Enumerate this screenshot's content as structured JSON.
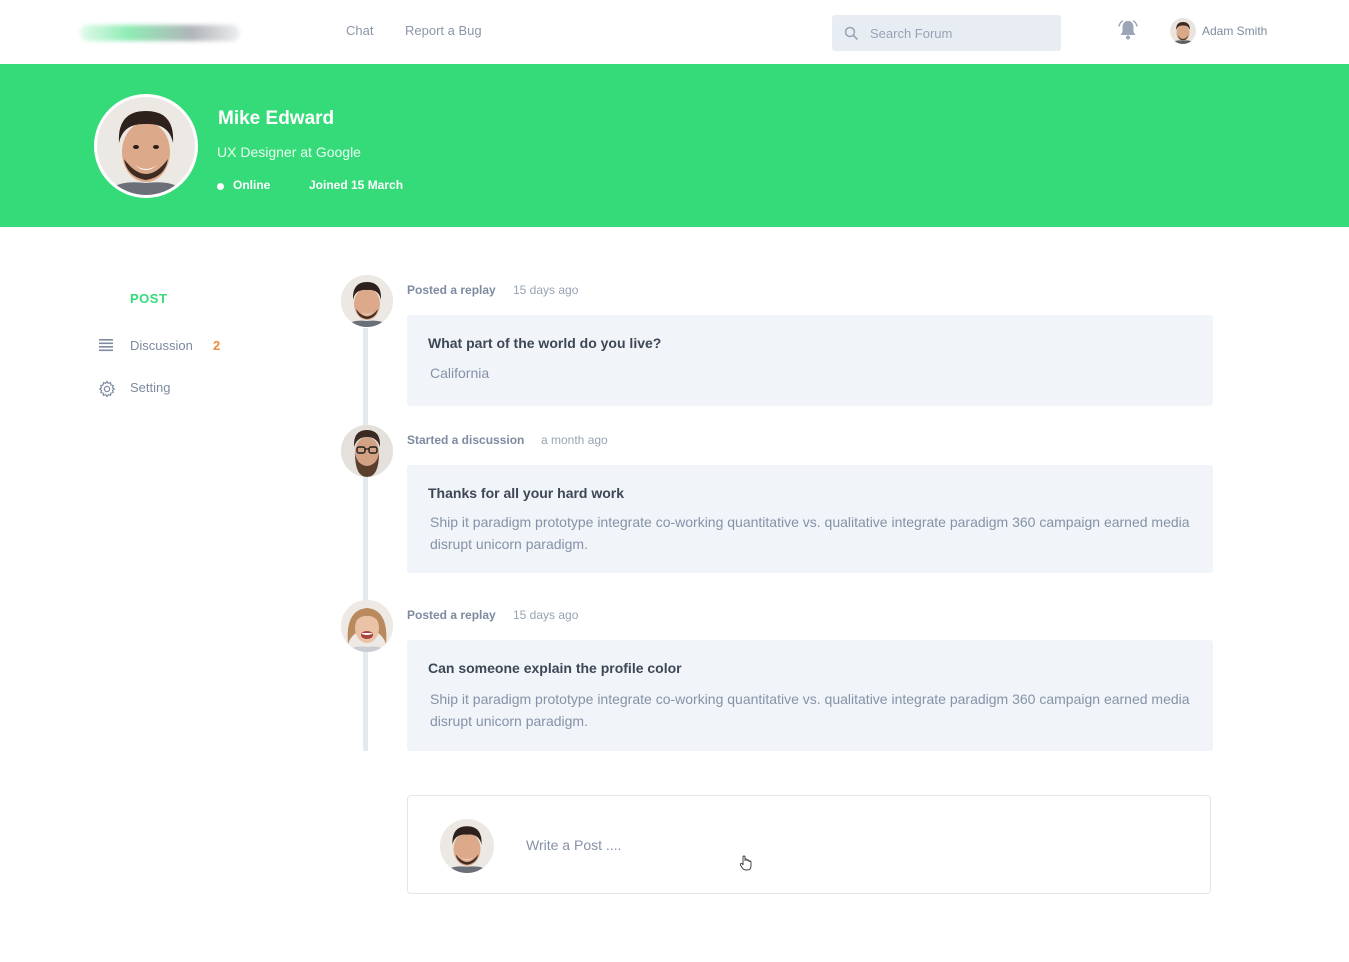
{
  "nav": {
    "links": [
      "Chat",
      "Report a Bug"
    ],
    "search_placeholder": "Search Forum",
    "user_name": "Adam Smith"
  },
  "profile": {
    "name": "Mike Edward",
    "title": "UX Designer at Google",
    "status": "Online",
    "joined": "Joined 15 March"
  },
  "sidebar": {
    "heading": "POST",
    "items": [
      {
        "label": "Discussion",
        "count": "2",
        "icon": "list-icon"
      },
      {
        "label": "Setting",
        "icon": "gear-icon"
      }
    ]
  },
  "feed": [
    {
      "action": "Posted a replay",
      "time": "15 days ago",
      "title": "What part of the world do you live?",
      "body": "California"
    },
    {
      "action": "Started a discussion",
      "time": "a month ago",
      "title": "Thanks for all your hard work",
      "body": "Ship it paradigm prototype integrate co-working quantitative vs. qualitative integrate paradigm 360 campaign earned media disrupt unicorn paradigm."
    },
    {
      "action": "Posted a replay",
      "time": "15 days ago",
      "title": "Can someone explain the profile color",
      "body": "Ship it paradigm prototype integrate co-working quantitative vs. qualitative integrate paradigm 360 campaign earned media disrupt unicorn paradigm."
    }
  ],
  "composer": {
    "placeholder": "Write a Post ...."
  },
  "colors": {
    "brand_green": "#35db79",
    "badge_orange": "#f08a3c",
    "card_bg": "#f1f4f8"
  }
}
